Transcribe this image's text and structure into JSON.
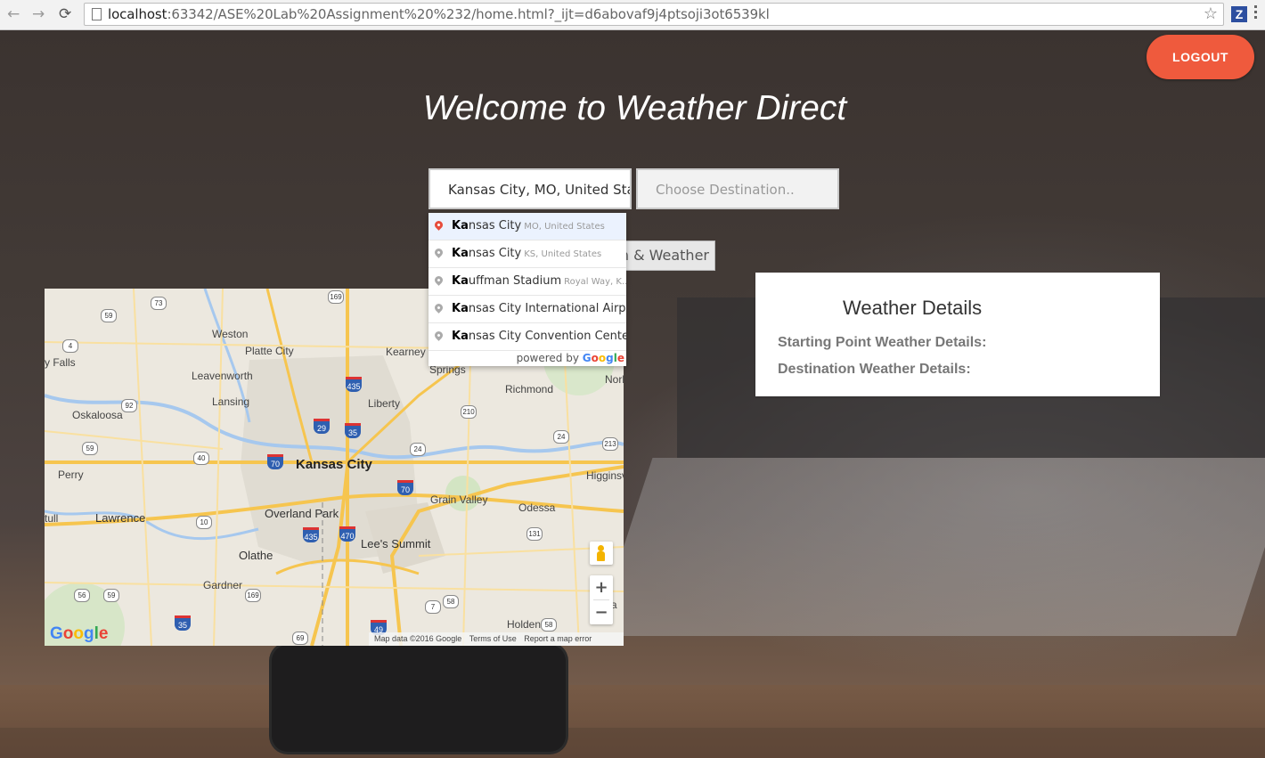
{
  "browser": {
    "url_host": "localhost",
    "url_path": ":63342/ASE%20Lab%20Assignment%20%232/home.html?_ijt=d6abovaf9j4ptsoji3ot6539kl",
    "back_icon": "←",
    "forward_icon": "→",
    "reload_icon": "⟳",
    "star_icon": "☆",
    "ext_label": "Z"
  },
  "header": {
    "logout_label": "LOGOUT",
    "title": "Welcome to Weather Direct"
  },
  "form": {
    "origin_value": "Kansas City, MO, United States",
    "destination_placeholder": "Choose Destination..",
    "route_button_label": "on & Weather"
  },
  "autocomplete": {
    "items": [
      {
        "match": "Ka",
        "rest": "nsas City",
        "secondary": "MO, United States"
      },
      {
        "match": "Ka",
        "rest": "nsas City",
        "secondary": "KS, United States"
      },
      {
        "match": "Ka",
        "rest": "uffman Stadium",
        "secondary": "Royal Way, K..."
      },
      {
        "match": "Ka",
        "rest": "nsas City International Airpo...",
        "secondary": ""
      },
      {
        "match": "Ka",
        "rest": "nsas City Convention Cente...",
        "secondary": ""
      }
    ],
    "powered_by": "powered by",
    "google_letters": [
      "G",
      "o",
      "o",
      "g",
      "l",
      "e"
    ]
  },
  "weather": {
    "title": "Weather Details",
    "start_label": "Starting Point Weather Details:",
    "dest_label": "Destination Weather Details:"
  },
  "map": {
    "cities": {
      "kansas_city": "Kansas City",
      "overland_park": "Overland Park",
      "lees_summit": "Lee's Summit",
      "olathe": "Olathe",
      "lawrence": "Lawrence",
      "liberty": "Liberty",
      "leavenworth": "Leavenworth",
      "lansing": "Lansing",
      "platte_city": "Platte City",
      "weston": "Weston",
      "kearney": "Kearney",
      "richmond": "Richmond",
      "grain_valley": "Grain Valley",
      "odessa": "Odessa",
      "oskaloosa": "Oskaloosa",
      "perry": "Perry",
      "gardner": "Gardner",
      "holden": "Holden",
      "higginsv": "Higginsv",
      "springs": "Springs",
      "falls": "y Falls",
      "tull": "tull",
      "norb": "Norb",
      "wab": "Wa"
    },
    "attribution": {
      "data": "Map data ©2016 Google",
      "terms": "Terms of Use",
      "report": "Report a map error"
    },
    "logo": [
      "G",
      "o",
      "o",
      "g",
      "l",
      "e"
    ],
    "zoom_in": "+",
    "zoom_out": "−"
  }
}
